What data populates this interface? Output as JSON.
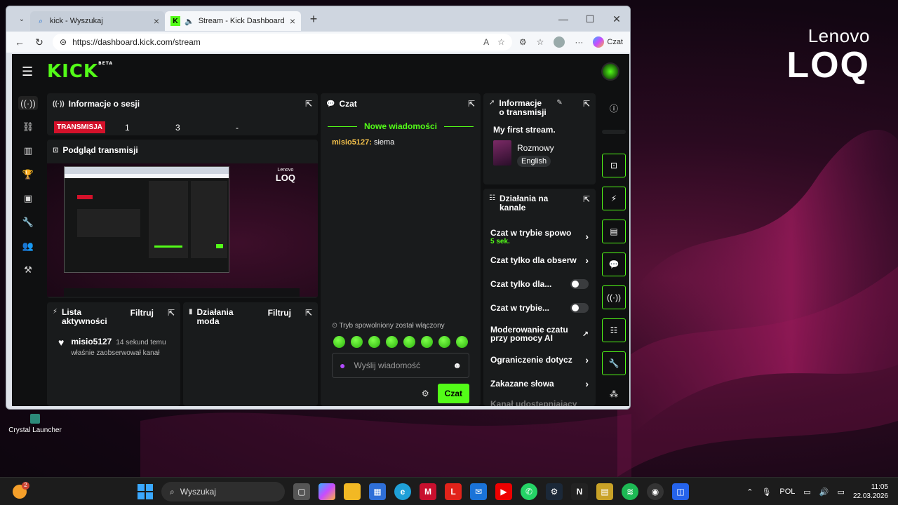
{
  "wallpaper": {
    "brand_top": "Lenovo",
    "brand_bottom": "LOQ"
  },
  "desktop": {
    "icon_label": "Crystal Launcher"
  },
  "browser": {
    "tabs": [
      {
        "label": "kick - Wyszukaj",
        "active": false
      },
      {
        "label": "Stream - Kick Dashboard",
        "active": true
      }
    ],
    "url": "https://dashboard.kick.com/stream",
    "copilot_label": "Czat"
  },
  "app": {
    "logo": "KICK",
    "logo_beta": "BETA",
    "session": {
      "title": "Informacje o sesji",
      "live_badge": "TRANSMISJA",
      "stats": [
        "1",
        "3",
        "-"
      ]
    },
    "preview": {
      "title": "Podgląd transmisji",
      "brand_top": "Lenovo",
      "brand_bottom": "LOQ"
    },
    "activity": {
      "title": "Lista aktywności",
      "filter": "Filtruj",
      "items": [
        {
          "user": "misio5127",
          "time": "14 sekund temu",
          "desc": "właśnie zaobserwował kanał"
        }
      ]
    },
    "mod_actions": {
      "title": "Działania moda",
      "filter": "Filtruj"
    },
    "chat": {
      "title": "Czat",
      "divider": "Nowe wiadomości",
      "messages": [
        {
          "user": "misio5127:",
          "text": "siema"
        }
      ],
      "slowmode_notice": "Tryb spowolniony został włączony",
      "input_placeholder": "Wyślij wiadomość",
      "send_label": "Czat"
    },
    "stream_info": {
      "title": "Informacje o transmisji",
      "stream_title": "My first stream.",
      "category": "Rozmowy",
      "language_tag": "English"
    },
    "channel_actions": {
      "title": "Działania na kanale",
      "items": [
        {
          "label": "Czat w trybie spowo",
          "sub": "5 sek.",
          "control": "chevron"
        },
        {
          "label": "Czat tylko dla obserw",
          "control": "chevron"
        },
        {
          "label": "Czat tylko dla...",
          "control": "toggle"
        },
        {
          "label": "Czat w trybie...",
          "control": "toggle"
        },
        {
          "label": "Moderowanie czatu przy pomocy AI",
          "control": "external"
        },
        {
          "label": "Ograniczenie dotycz",
          "control": "chevron"
        },
        {
          "label": "Zakazane słowa",
          "control": "chevron"
        },
        {
          "label": "Kanał udostępniający",
          "control": "none"
        }
      ]
    }
  },
  "taskbar": {
    "search_placeholder": "Wyszukaj",
    "weather_badge": "2",
    "language": "POL",
    "time": "11:05",
    "date": "22.03.2026"
  },
  "colors": {
    "kick_green": "#53fc18",
    "live_red": "#d4112a"
  }
}
